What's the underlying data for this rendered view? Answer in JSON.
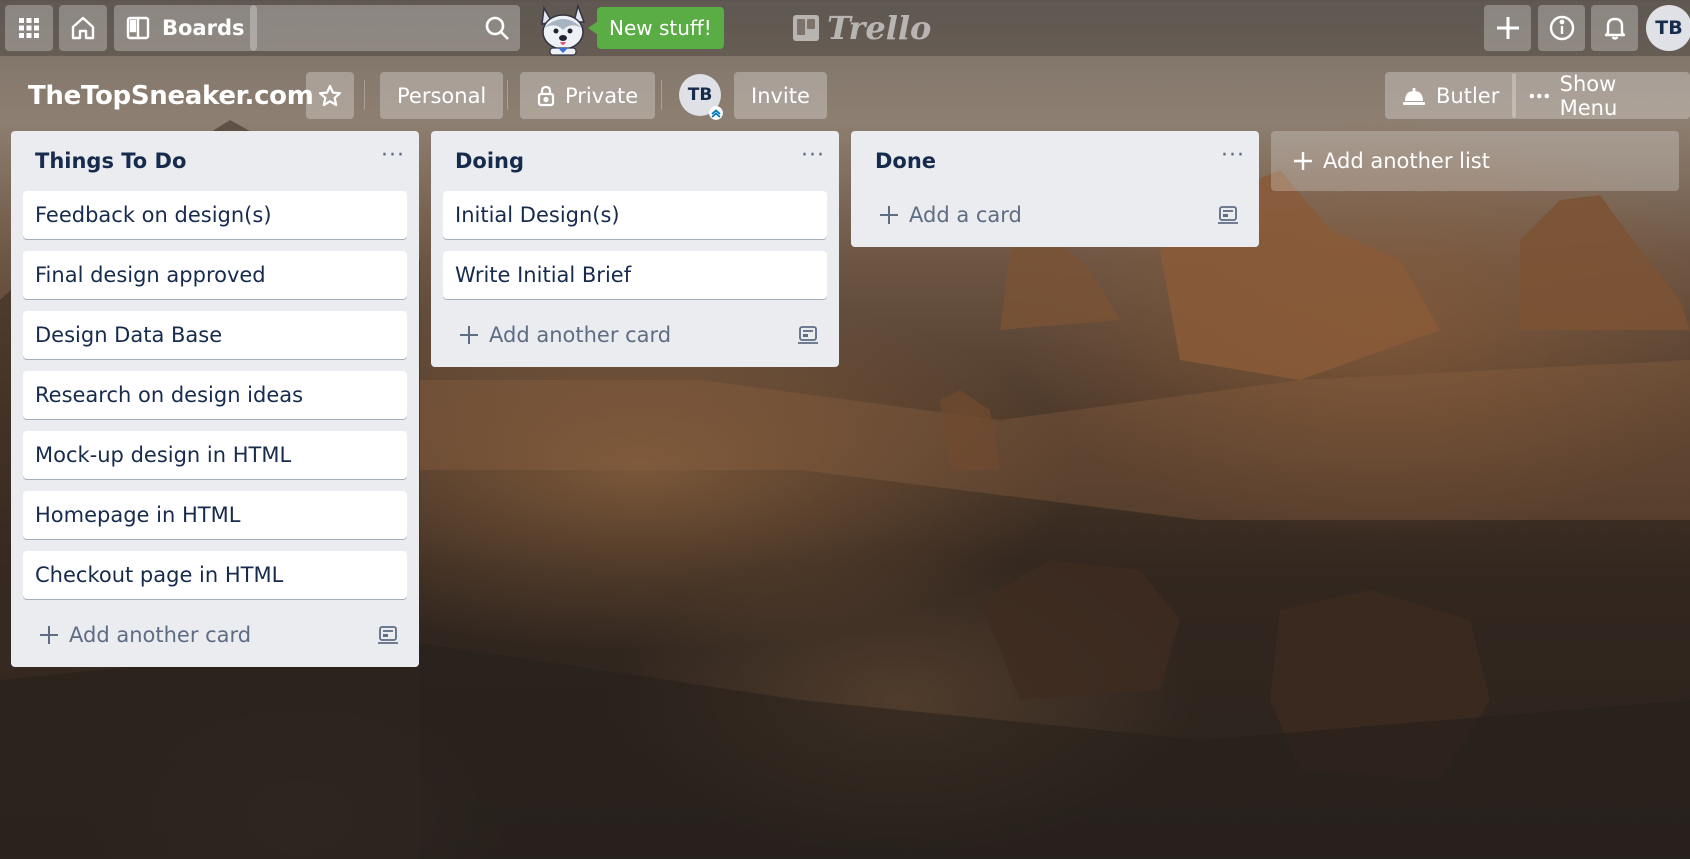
{
  "topbar": {
    "apps_icon": "grid-icon",
    "home_icon": "house-icon",
    "boards_label": "Boards",
    "search_value": "",
    "new_stuff_label": "New stuff!",
    "logo_text": "Trello",
    "create_icon": "plus-icon",
    "info_icon": "info-icon",
    "notifications_icon": "bell-icon",
    "avatar_initials": "TB"
  },
  "board": {
    "title": "TheTopSneaker.com",
    "star_icon": "star-icon",
    "team_label": "Personal",
    "visibility_label": "Private",
    "member_initials": "TB",
    "invite_label": "Invite",
    "butler_label": "Butler",
    "show_menu_label": "Show Menu"
  },
  "lists": [
    {
      "title": "Things To Do",
      "cards": [
        "Feedback on design(s)",
        "Final design approved",
        "Design Data Base",
        "Research on design ideas",
        "Mock-up design in HTML",
        "Homepage in HTML",
        "Checkout page in HTML"
      ],
      "add_label": "Add another card"
    },
    {
      "title": "Doing",
      "cards": [
        "Initial Design(s)",
        "Write Initial Brief"
      ],
      "add_label": "Add another card"
    },
    {
      "title": "Done",
      "cards": [],
      "add_label": "Add a card"
    }
  ],
  "add_list_label": "Add another list",
  "colors": {
    "accent_green": "#5aac44",
    "list_bg": "#ebecf0",
    "card_text": "#172b4d",
    "muted_text": "#5e6c84"
  }
}
